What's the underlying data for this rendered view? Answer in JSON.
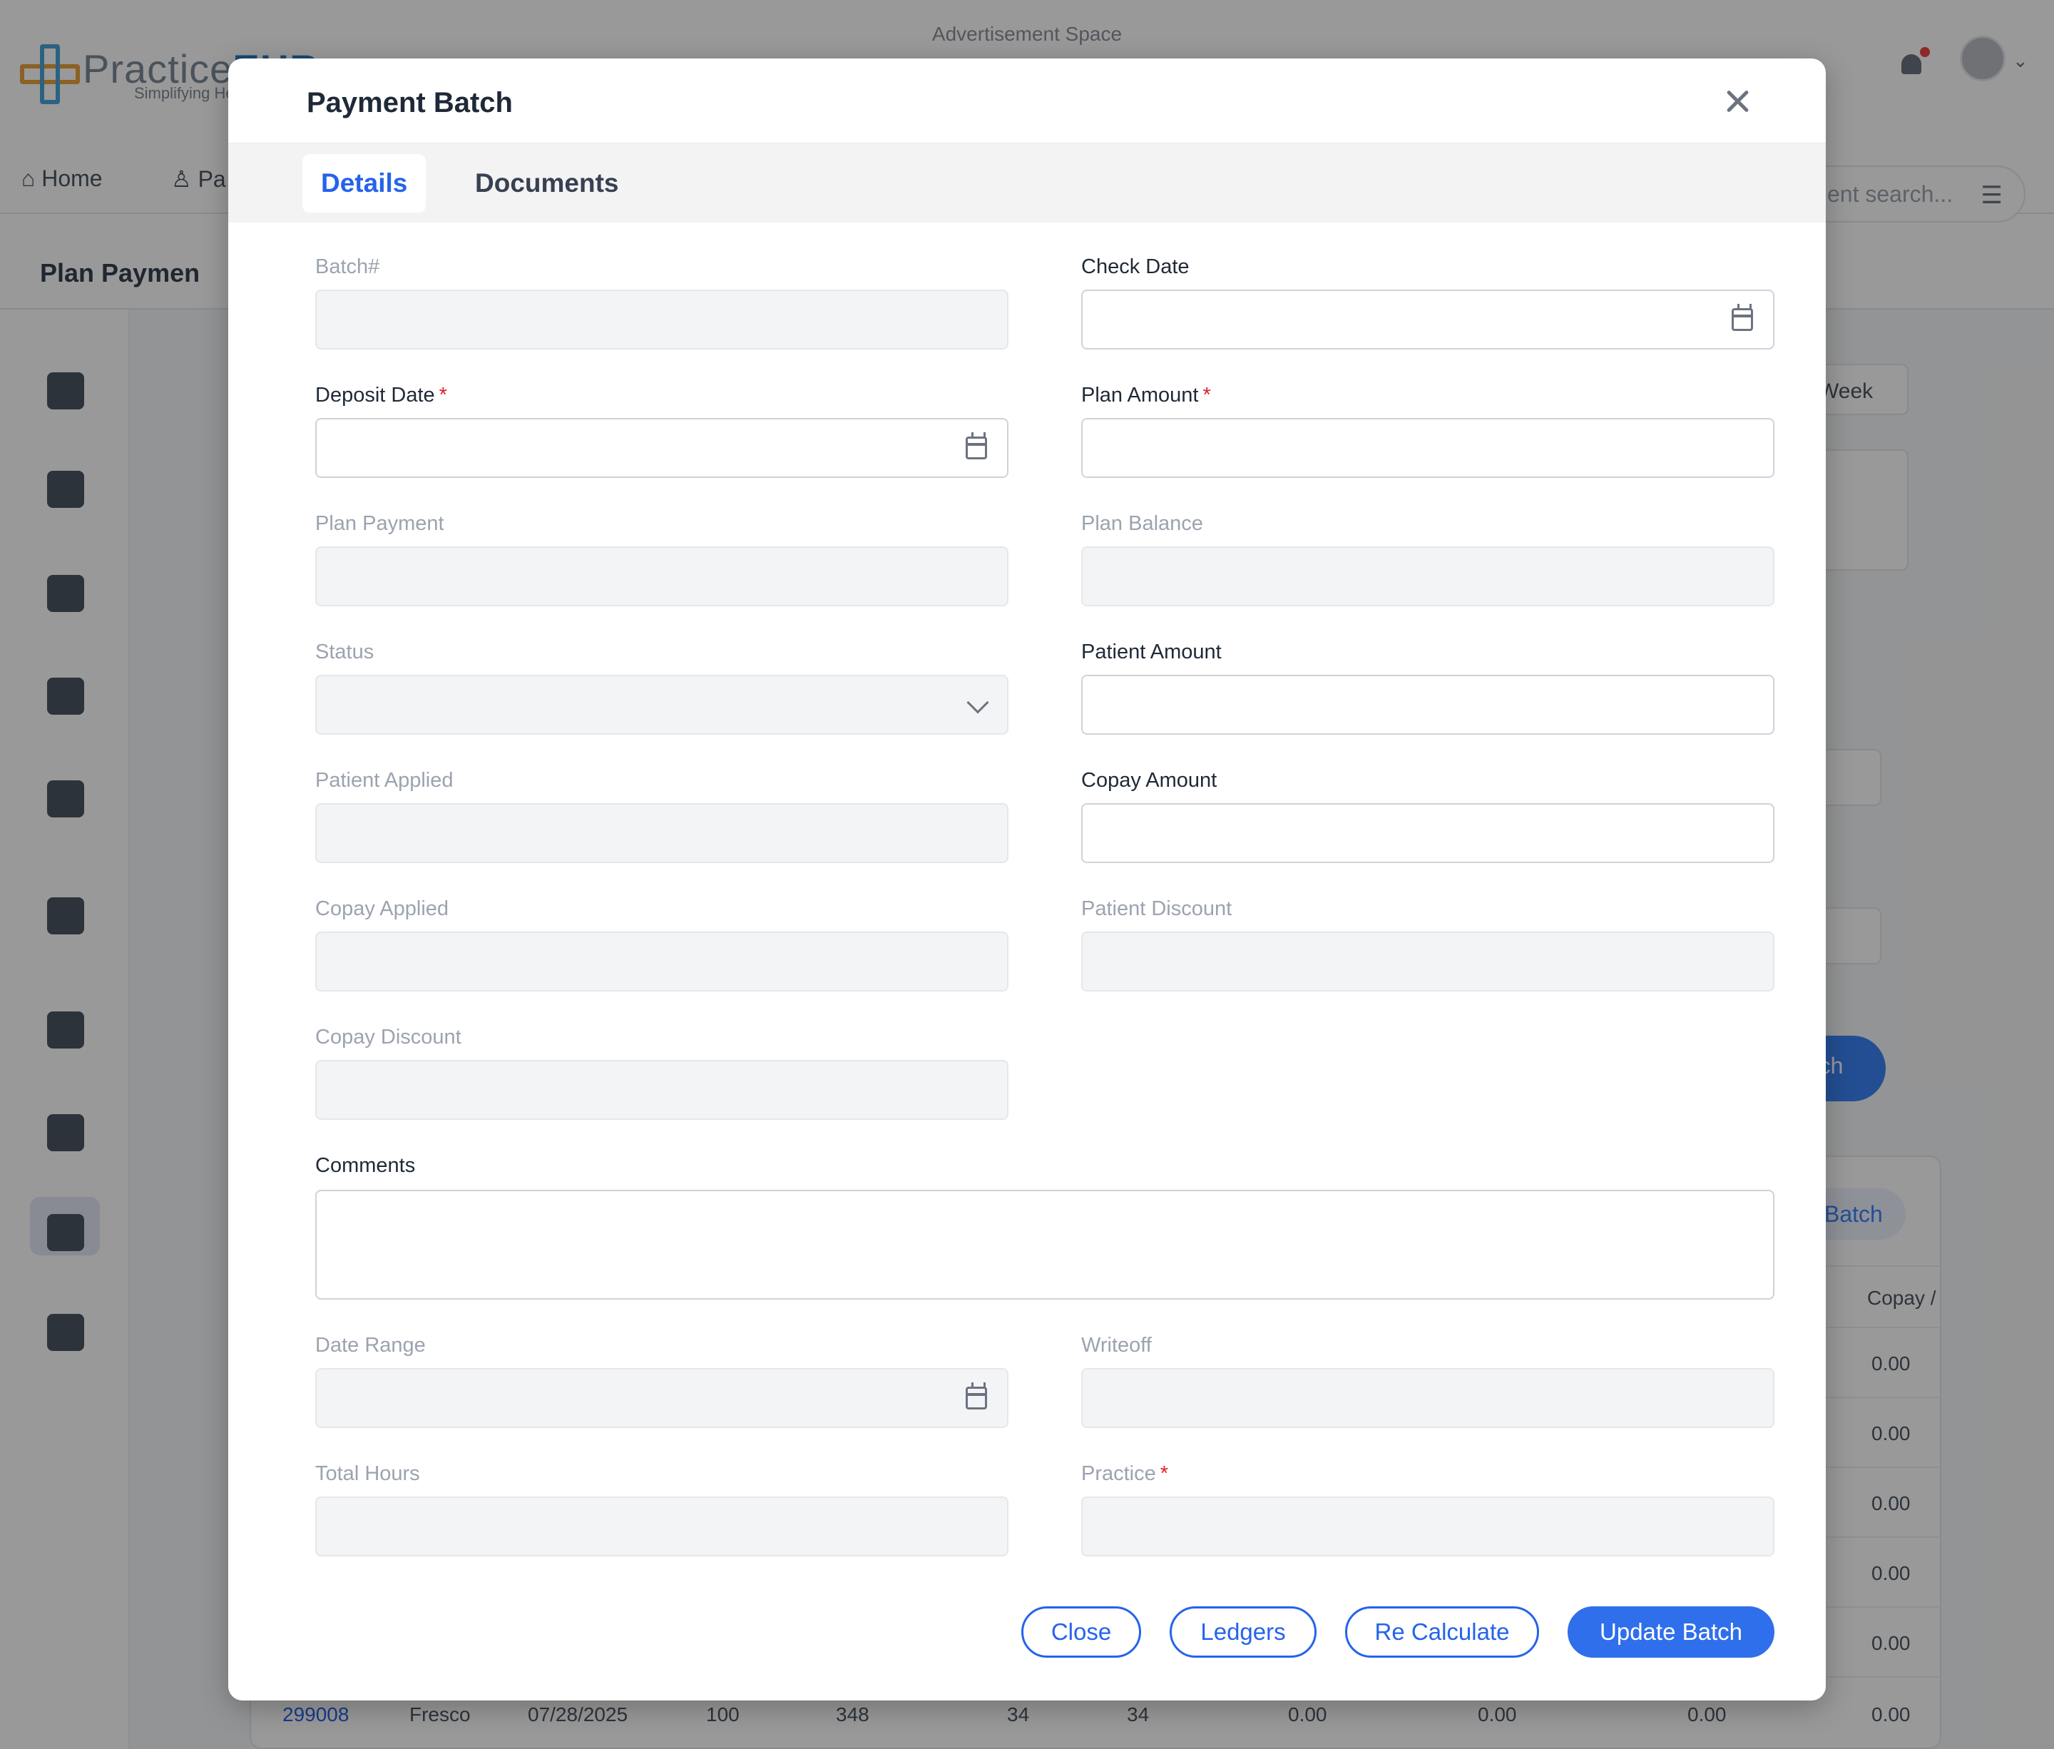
{
  "background": {
    "ad_space": "Advertisement Space",
    "logo": {
      "name": "Practice",
      "highlight": "EHR",
      "tagline": "Simplifying He"
    },
    "nav": {
      "home": "Home",
      "second": "Pa",
      "search_placeholder": "ent search..."
    },
    "page_title": "Plan Paymen",
    "week_select": "Week",
    "search_button": "rch",
    "batch_button": "Batch",
    "table_header_copay": "Copay /",
    "right_values": [
      "0.00",
      "0.00",
      "0.00",
      "0.00",
      "0.00"
    ],
    "last_row": {
      "batch": "299008",
      "name": "Fresco",
      "date": "07/28/2025",
      "c1": "100",
      "c2": "348",
      "c3": "34",
      "c4": "34",
      "c5": "0.00",
      "c6": "0.00",
      "c7": "0.00",
      "c8": "0.00"
    }
  },
  "modal": {
    "title": "Payment Batch",
    "tabs": [
      {
        "label": "Details",
        "active": true
      },
      {
        "label": "Documents",
        "active": false
      }
    ],
    "fields": {
      "batch_no": {
        "label": "Batch#",
        "value": ""
      },
      "check_date": {
        "label": "Check Date",
        "value": ""
      },
      "deposit_date": {
        "label": "Deposit Date",
        "required": "*",
        "value": ""
      },
      "plan_amount": {
        "label": "Plan Amount",
        "required": "*",
        "value": ""
      },
      "plan_payment": {
        "label": "Plan Payment",
        "value": ""
      },
      "plan_balance": {
        "label": "Plan Balance",
        "value": ""
      },
      "status": {
        "label": "Status",
        "value": ""
      },
      "patient_amount": {
        "label": "Patient Amount",
        "value": ""
      },
      "patient_applied": {
        "label": "Patient Applied",
        "value": ""
      },
      "copay_amount": {
        "label": "Copay Amount",
        "value": ""
      },
      "copay_applied": {
        "label": "Copay Applied",
        "value": ""
      },
      "patient_discount": {
        "label": "Patient Discount",
        "value": ""
      },
      "copay_discount": {
        "label": "Copay Discount",
        "value": ""
      },
      "comments": {
        "label": "Comments",
        "value": ""
      },
      "date_range": {
        "label": "Date Range",
        "value": ""
      },
      "writeoff": {
        "label": "Writeoff",
        "value": ""
      },
      "total_hours": {
        "label": "Total Hours",
        "value": ""
      },
      "practice": {
        "label": "Practice",
        "required": "*",
        "value": ""
      }
    },
    "buttons": {
      "close": "Close",
      "ledgers": "Ledgers",
      "recalculate": "Re Calculate",
      "update": "Update Batch"
    }
  },
  "colors": {
    "accent": "#2563eb",
    "required": "#e11d2a"
  }
}
